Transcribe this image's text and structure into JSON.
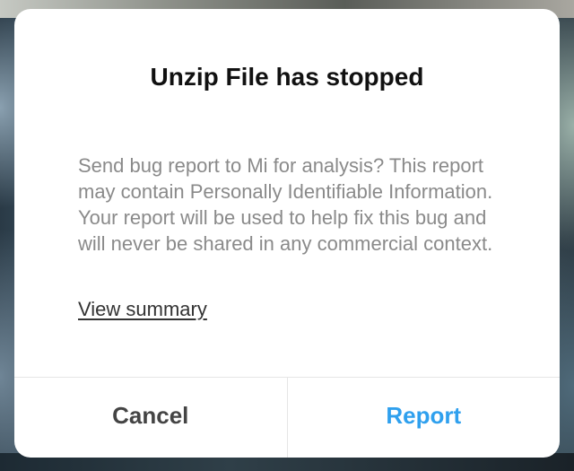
{
  "dialog": {
    "title": "Unzip File has stopped",
    "message": "Send bug report to Mi for analysis? This report may contain Personally Identifiable Information. Your report will be used to help fix this bug and will never be shared in any commercial context.",
    "link_label": "View summary",
    "buttons": {
      "cancel_label": "Cancel",
      "report_label": "Report"
    }
  },
  "colors": {
    "accent": "#2fa0ee",
    "title_text": "#111111",
    "body_text": "#8a8a8a",
    "cancel_text": "#444444"
  }
}
